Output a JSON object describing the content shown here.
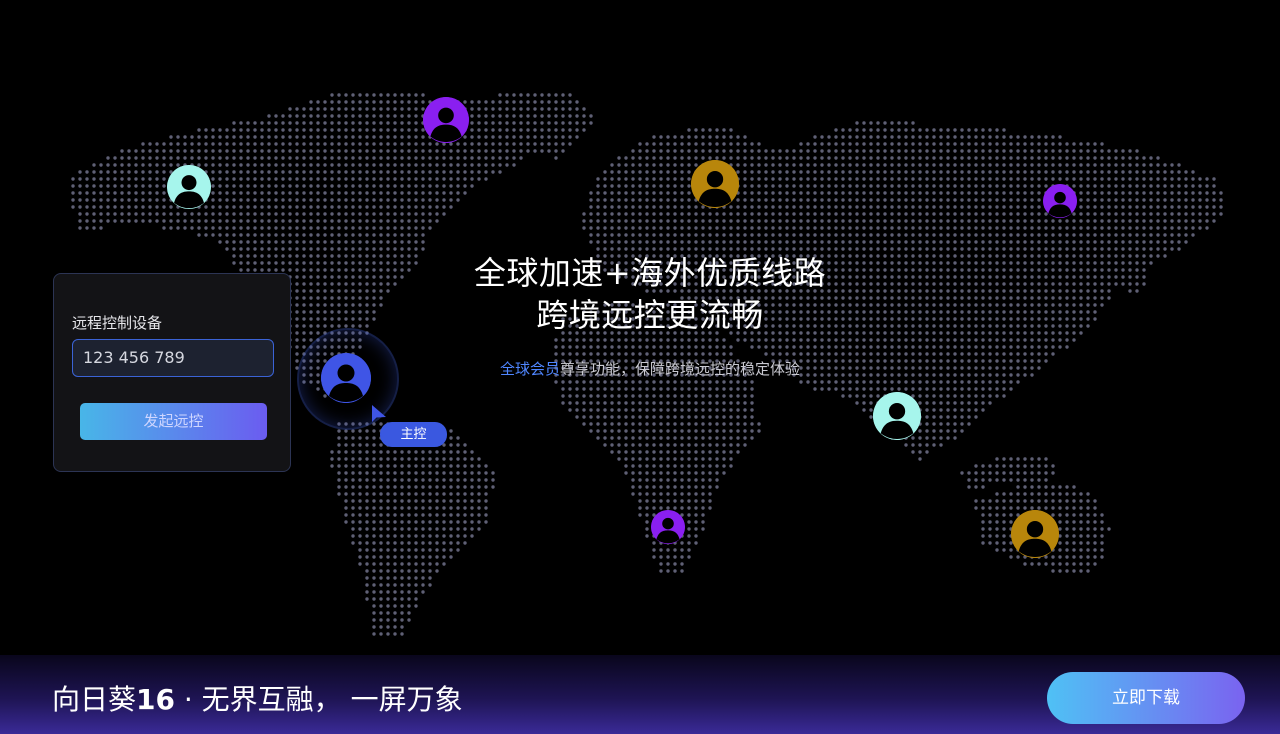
{
  "hero": {
    "title_line1": "全球加速+海外优质线路",
    "title_line2": "跨境远控更流畅",
    "subtitle_highlight": "全球会员",
    "subtitle_rest": "尊享功能，保障跨境远控的稳定体验"
  },
  "remote_panel": {
    "label": "远程控制设备",
    "device_code": "123 456 789",
    "start_button": "发起远控"
  },
  "master_tag": "主控",
  "bottom_bar": {
    "slogan_prefix": "向日葵",
    "slogan_number": "16",
    "slogan_suffix": " · 无界互融， 一屏万象",
    "download_button": "立即下载"
  },
  "colors": {
    "avatar_cyan": "#a6f5ec",
    "avatar_purple": "#8a1ff0",
    "avatar_gold": "#b8860b",
    "avatar_blue": "#3f55e6",
    "accent_blue": "#4f86ff"
  },
  "icons": {
    "user_avatar": "user-avatar-icon",
    "cursor": "cursor-arrow-icon"
  }
}
